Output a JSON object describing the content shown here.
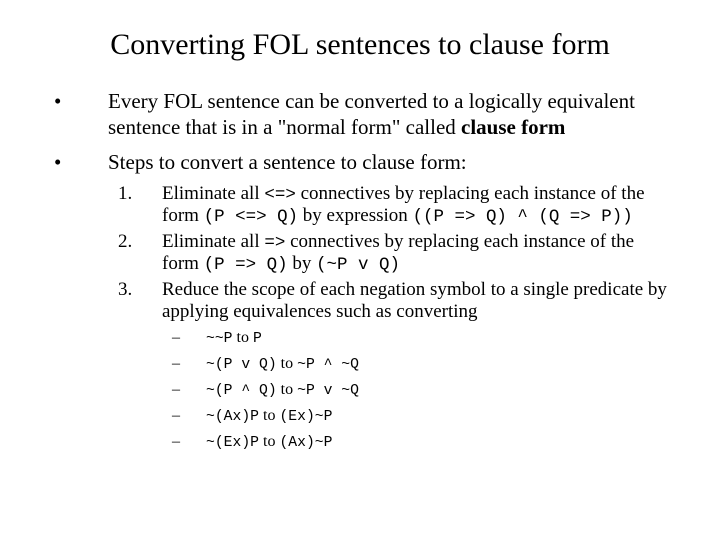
{
  "title": "Converting FOL sentences to clause form",
  "bullets": [
    {
      "pre": "Every FOL sentence can be converted to a logically equivalent sentence that is in a \"normal form\" called ",
      "b": "clause form"
    },
    {
      "pre": "Steps to convert a sentence to clause form:"
    }
  ],
  "steps": [
    {
      "n": "1.",
      "a": "Eliminate all ",
      "c1": "<=>",
      "b": " connectives by replacing each instance of the form ",
      "c2": "(P <=> Q)",
      "d": " by expression ",
      "c3": "((P => Q) ^ (Q => P))"
    },
    {
      "n": "2.",
      "a": "Eliminate all ",
      "c1": "=>",
      "b": " connectives by replacing each instance of the form ",
      "c2": "(P => Q)",
      "d": " by ",
      "c3": "(~P v Q)"
    },
    {
      "n": "3.",
      "a": "Reduce the scope of each negation symbol to a single predicate by applying equivalences such as converting"
    }
  ],
  "eq": [
    {
      "l": "~~P",
      "m": " to ",
      "r": "P"
    },
    {
      "l": "~(P v Q)",
      "m": " to ",
      "r": "~P ^ ~Q"
    },
    {
      "l": "~(P ^ Q)",
      "m": " to ",
      "r": "~P v ~Q"
    },
    {
      "l": "~(Ax)P",
      "m": " to ",
      "r": "(Ex)~P"
    },
    {
      "l": "~(Ex)P",
      "m": " to ",
      "r": "(Ax)~P"
    }
  ]
}
